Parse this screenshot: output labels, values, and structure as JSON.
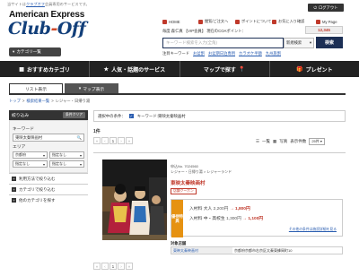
{
  "notice": {
    "prefix": "当サイトは",
    "link": "クラブオフ",
    "suffix": "会員専用のサービスです。"
  },
  "brand": {
    "line1": "American Express",
    "line2a": "Club",
    "line2b": "-",
    "line2c": "Off"
  },
  "category_button": "カテゴリ一覧",
  "logout": "ログアウト",
  "topnav": [
    {
      "label": "HOME",
      "color": "#c0392b"
    },
    {
      "label": "閲覧/ご注文へ",
      "color": "#c0392b"
    },
    {
      "label": "ポイントについて",
      "color": "#c0392b"
    },
    {
      "label": "お気に入り確認",
      "color": "#c0392b"
    },
    {
      "label": "My Page",
      "color": "#c0392b"
    }
  ],
  "user": {
    "greeting": "毎度 森仁真",
    "rank": "【VIP会員】",
    "points_label": "現在のCOAポイント：",
    "points": "12,345"
  },
  "search": {
    "placeholder": "キーワード検索を入力(全角) ",
    "select": "新規検索",
    "button": "検索"
  },
  "hot_keywords": {
    "label": "注目キーワード",
    "items": [
      "お盆割",
      "お盆期日泊専用",
      "カラオケ半額",
      "九州旅割"
    ]
  },
  "mainnav": [
    "おすすめカテゴリ",
    "人気・話題のサービス",
    "マップで探す",
    "プレゼント"
  ],
  "tabs": {
    "list": "リスト表示",
    "map": "マップ表示"
  },
  "breadcrumb": [
    "トップ",
    ">",
    "検索結果一覧",
    ">",
    "レジャー・日帰り湯"
  ],
  "sidebar": {
    "header": "絞り込み",
    "clear": "条件クリア",
    "keyword_label": "キーワード",
    "keyword_value": "東映太秦映画村",
    "area_label": "エリア",
    "area_selects": [
      "京都府",
      "指定なし",
      "指定なし",
      "指定なし"
    ],
    "links": [
      "利用方法で絞り込む",
      "カテゴリで絞り込む",
      "他のカテゴリを探す"
    ]
  },
  "filter": {
    "label": "選択中の条件：",
    "item": "キーワード:東映太秦映画村"
  },
  "result_count": "1件",
  "pagination": {
    "pages": [
      "«",
      "‹",
      "1",
      "›",
      "»"
    ],
    "current": "1"
  },
  "view_options": {
    "list": "一覧",
    "grid": "写真",
    "per_page_label": "表示件数",
    "per_page": "25件"
  },
  "product": {
    "id": "申込No. 7024560",
    "category": "レジャー・日帰り湯 > レジャーランド",
    "name": "東映太秦映画村",
    "coupon": "店舗クーポン",
    "tag": "優待特典",
    "price1_label": "入村料 大人",
    "price1_orig": "2,200円",
    "price1_sale": "1,800円",
    "price2_label": "入村料 中・高校生",
    "price2_orig": "1,300円",
    "price2_sale": "1,100円",
    "more_link": "その他の条件は施設詳細を見る",
    "stores_title": "対象店舗",
    "store_name": "東映太秦映画村",
    "store_addr": "京都府京都市右京区太秦東蜂岡町10"
  }
}
